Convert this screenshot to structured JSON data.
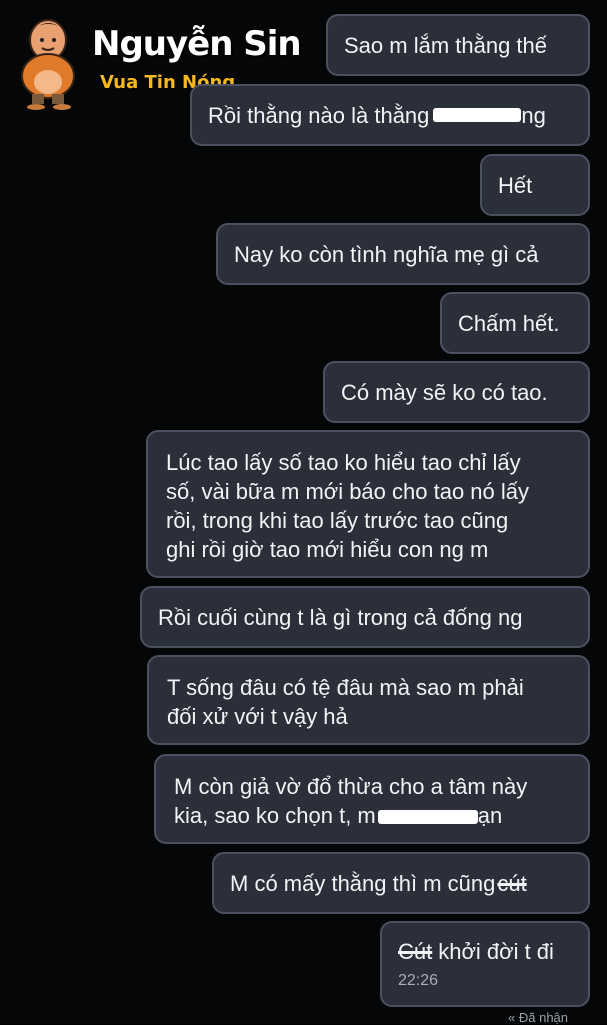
{
  "brand": {
    "name": "Nguyễn Sin",
    "tagline": "Vua Tin Nóng"
  },
  "messages": [
    {
      "text": "Sao m lắm thằng thế"
    },
    {
      "text_before": "Rồi thằng nào là thằng",
      "text_after": "ng"
    },
    {
      "text": "Hết"
    },
    {
      "text": "Nay ko còn tình nghĩa mẹ gì cả"
    },
    {
      "text": "Chấm hết."
    },
    {
      "text": "Có mày sẽ ko có tao."
    },
    {
      "lines": [
        "Lúc tao lấy số tao ko hiểu tao chỉ lấy",
        "số, vài bữa m mới báo cho tao nó lấy",
        "rồi, trong khi tao lấy trước tao cũng",
        "ghi rồi giờ tao mới hiểu con ng m"
      ]
    },
    {
      "text": "Rồi cuối cùng t là gì trong cả đống ng"
    },
    {
      "lines": [
        "T sống đâu có tệ đâu mà sao m phải",
        "đối xử với t vậy hả"
      ]
    },
    {
      "line1": "M còn giả vờ đổ thừa cho a tâm này",
      "line2_before": "kia, sao ko chọn t, m",
      "line2_after": "ạn"
    },
    {
      "text_before": "M có mấy thằng thì m cũng",
      "struck": "cút"
    },
    {
      "struck": "Cút",
      "text_after": "khởi đời t đi",
      "time": "22:26"
    }
  ],
  "status": "Đã nhận"
}
